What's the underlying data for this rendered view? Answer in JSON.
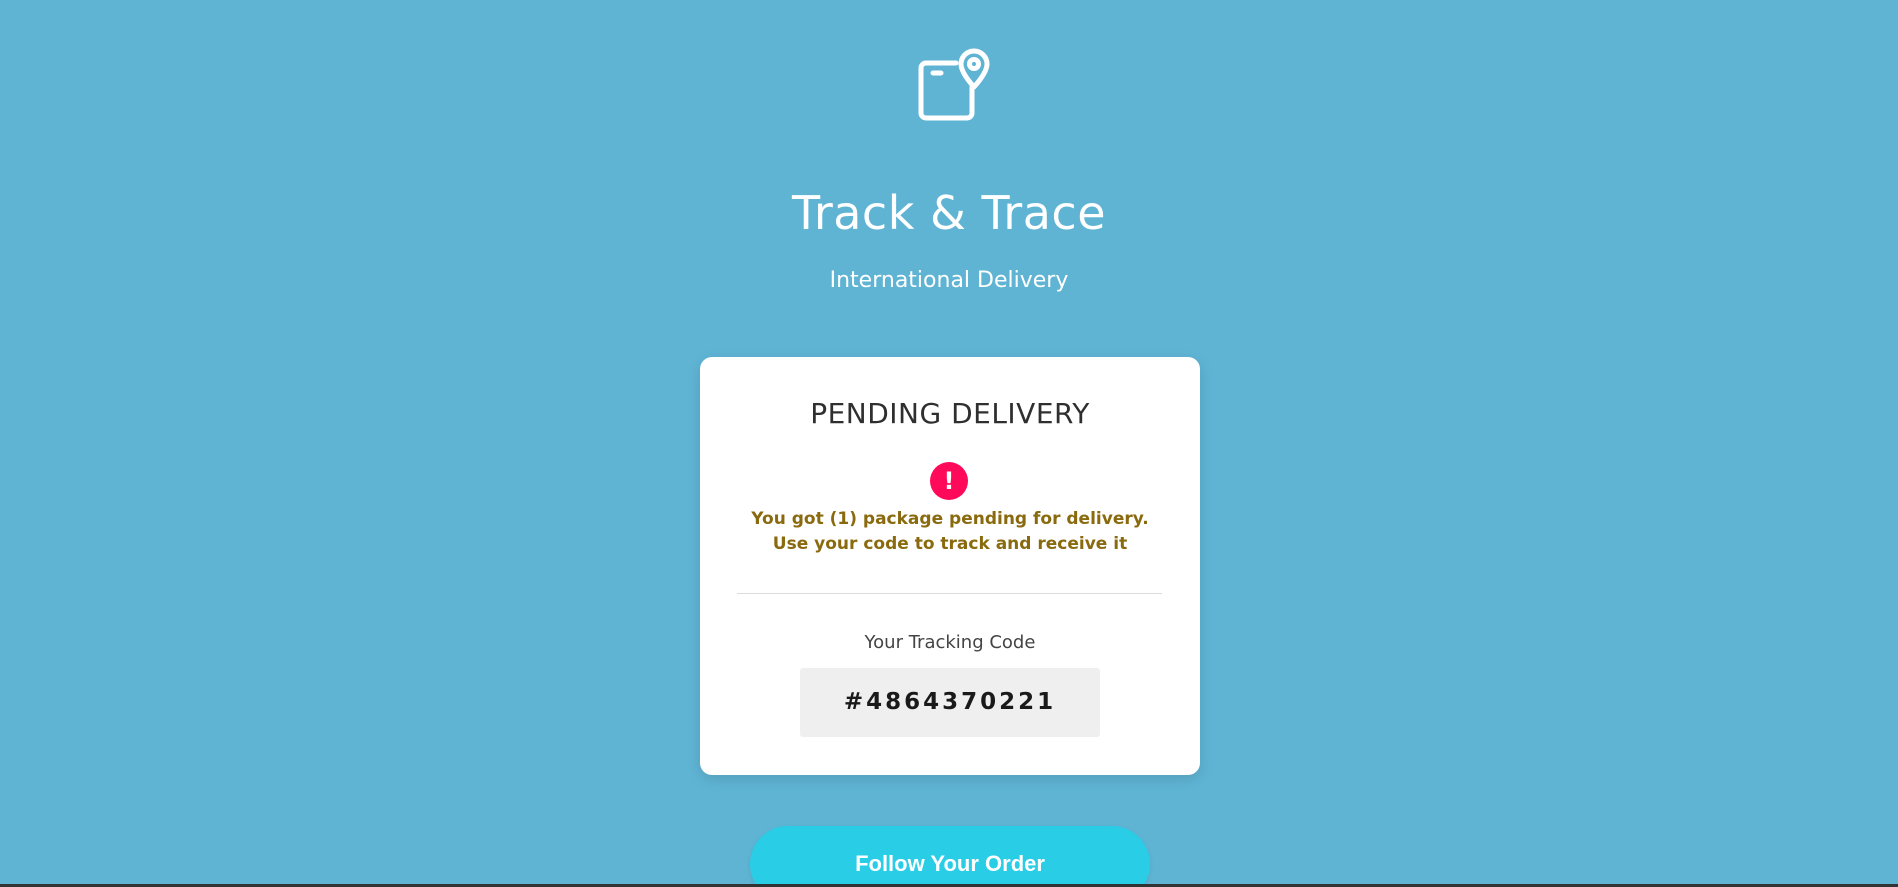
{
  "header": {
    "logo_icon": "package-location-icon",
    "title": "Track & Trace",
    "subtitle": "International Delivery"
  },
  "card": {
    "heading": "PENDING DELIVERY",
    "alert_icon": "exclamation-icon",
    "alert_glyph": "!",
    "notice_line1": "You got (1) package pending for delivery.",
    "notice_line2": "Use your code to track and receive it",
    "code_label": "Your Tracking Code",
    "code_value": "#4864370221"
  },
  "actions": {
    "follow_label": "Follow Your Order"
  },
  "colors": {
    "background": "#5fb4d4",
    "alert": "#ff0a5a",
    "notice_text": "#8a6a0e",
    "button": "#29cde6"
  }
}
